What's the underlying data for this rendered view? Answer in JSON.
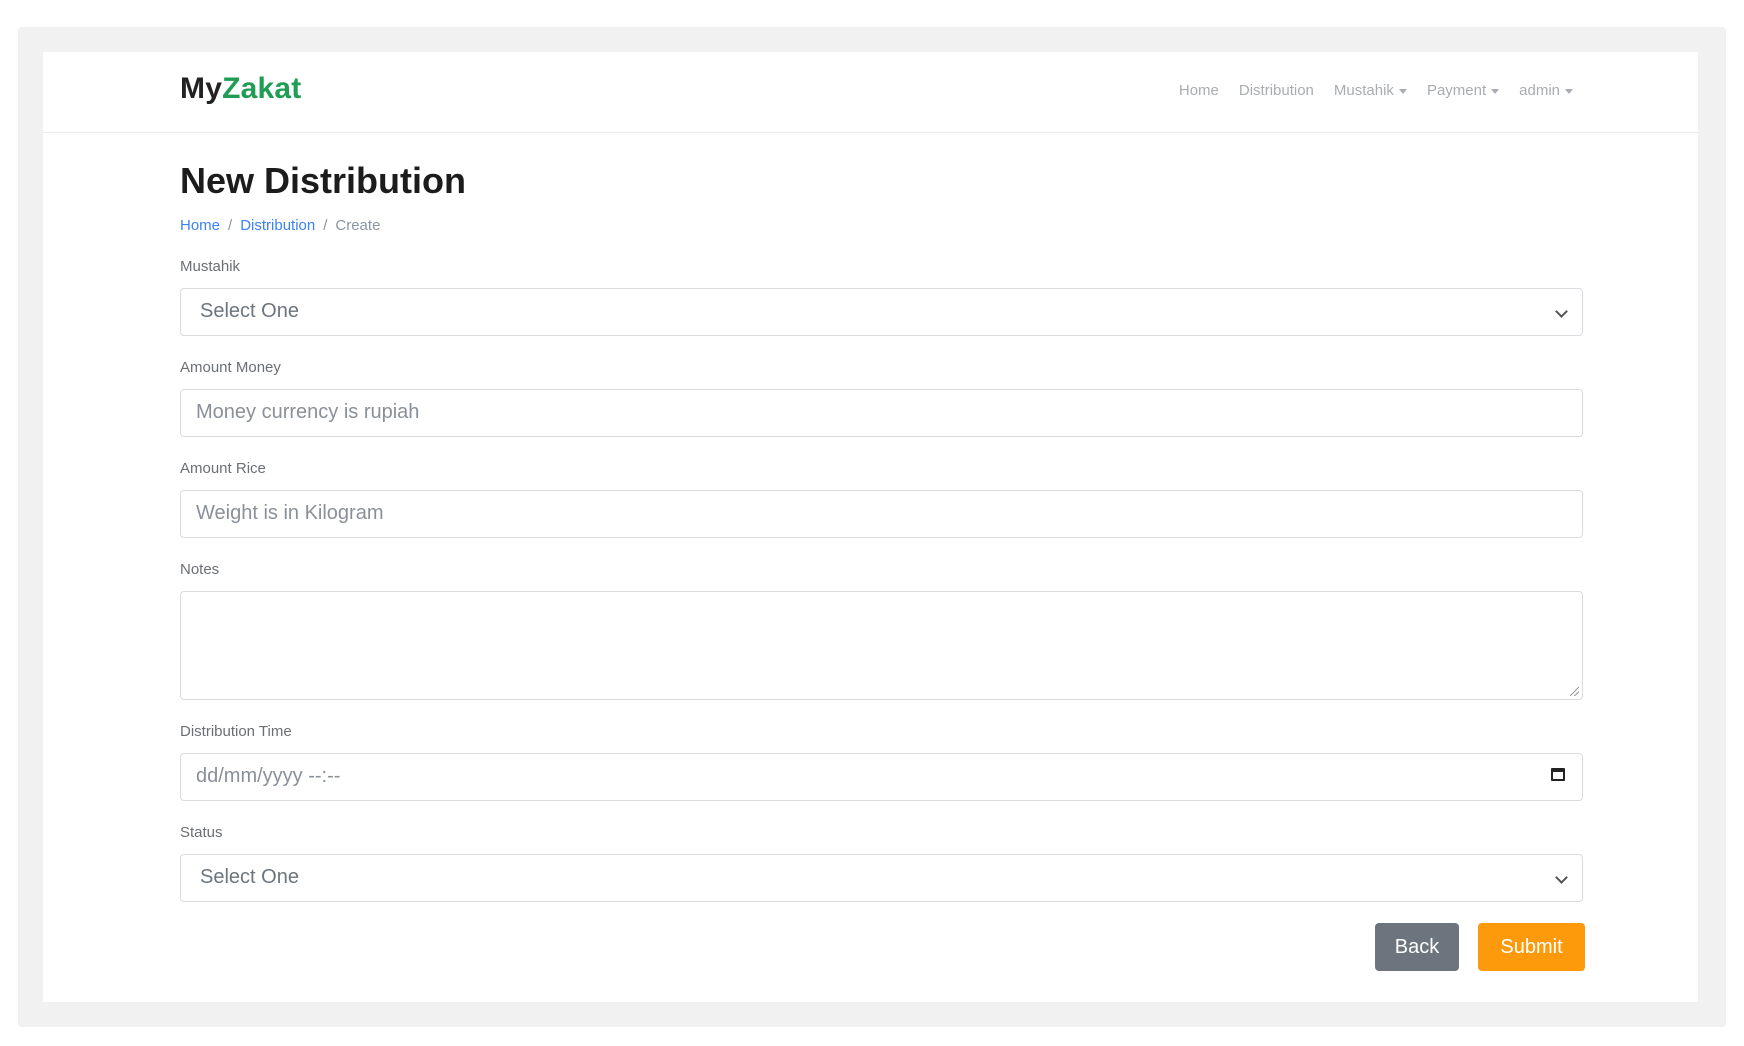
{
  "navbar": {
    "brand_prefix": "My",
    "brand_accent": "Zakat",
    "links": [
      {
        "label": "Home"
      },
      {
        "label": "Distribution"
      },
      {
        "label": "Mustahik"
      },
      {
        "label": "Payment"
      },
      {
        "label": "admin"
      }
    ]
  },
  "page": {
    "title": "New Distribution",
    "breadcrumb": [
      "Home",
      "/",
      "Distribution",
      "/",
      "Create"
    ]
  },
  "form": {
    "mustahik": {
      "label": "Mustahik",
      "value": "Select One"
    },
    "amount_money": {
      "label": "Amount Money",
      "placeholder": "Money currency is rupiah"
    },
    "amount_rice": {
      "label": "Amount Rice",
      "placeholder": "Weight is in Kilogram"
    },
    "notes": {
      "label": "Notes",
      "value": ""
    },
    "distribution_time": {
      "label": "Distribution Time",
      "placeholder": "dd/mm/yyyy --:--"
    },
    "status": {
      "label": "Status",
      "value": "Select One"
    },
    "back_label": "Back",
    "submit_label": "Submit"
  },
  "colors": {
    "brand_accent": "#1f9d55",
    "submit": "#fd9a0b",
    "back": "#6c757d",
    "link": "#3b82f6"
  }
}
